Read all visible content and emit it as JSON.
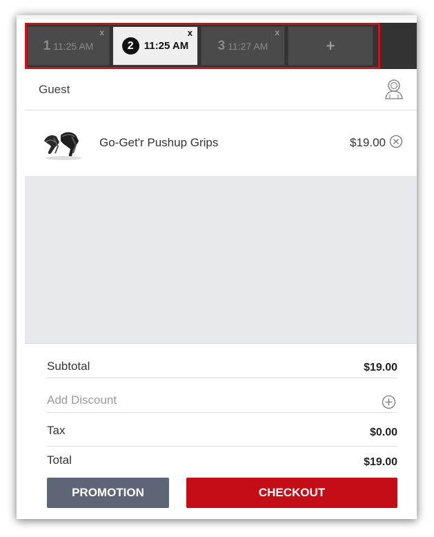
{
  "tabs": [
    {
      "number": "1",
      "time": "11:25 AM",
      "close": "x"
    },
    {
      "number": "2",
      "time": "11:25 AM",
      "close": "x"
    },
    {
      "number": "3",
      "time": "11:27 AM",
      "close": "x"
    },
    {
      "plus": "+"
    }
  ],
  "active_tab": 2,
  "customer": {
    "name": "Guest",
    "icon": "user-outline-icon"
  },
  "cart": {
    "items": [
      {
        "name": "Go-Get'r Pushup Grips",
        "price": "$19.00",
        "thumb_icon": "pushup-grips-image",
        "remove_icon": "circle-x-icon"
      }
    ]
  },
  "totals": {
    "subtotal_label": "Subtotal",
    "subtotal_value": "$19.00",
    "discount_label": "Add Discount",
    "discount_icon": "circle-plus-icon",
    "tax_label": "Tax",
    "tax_value": "$0.00",
    "total_label": "Total",
    "total_value": "$19.00"
  },
  "actions": {
    "promotion_label": "PROMOTION",
    "checkout_label": "CHECKOUT"
  },
  "colors": {
    "tabbar_bg": "#333333",
    "highlight_border": "#d0101b",
    "checkout_bg": "#c40d16",
    "promotion_bg": "#5d6677",
    "empty_area_bg": "#e8e9ec"
  }
}
